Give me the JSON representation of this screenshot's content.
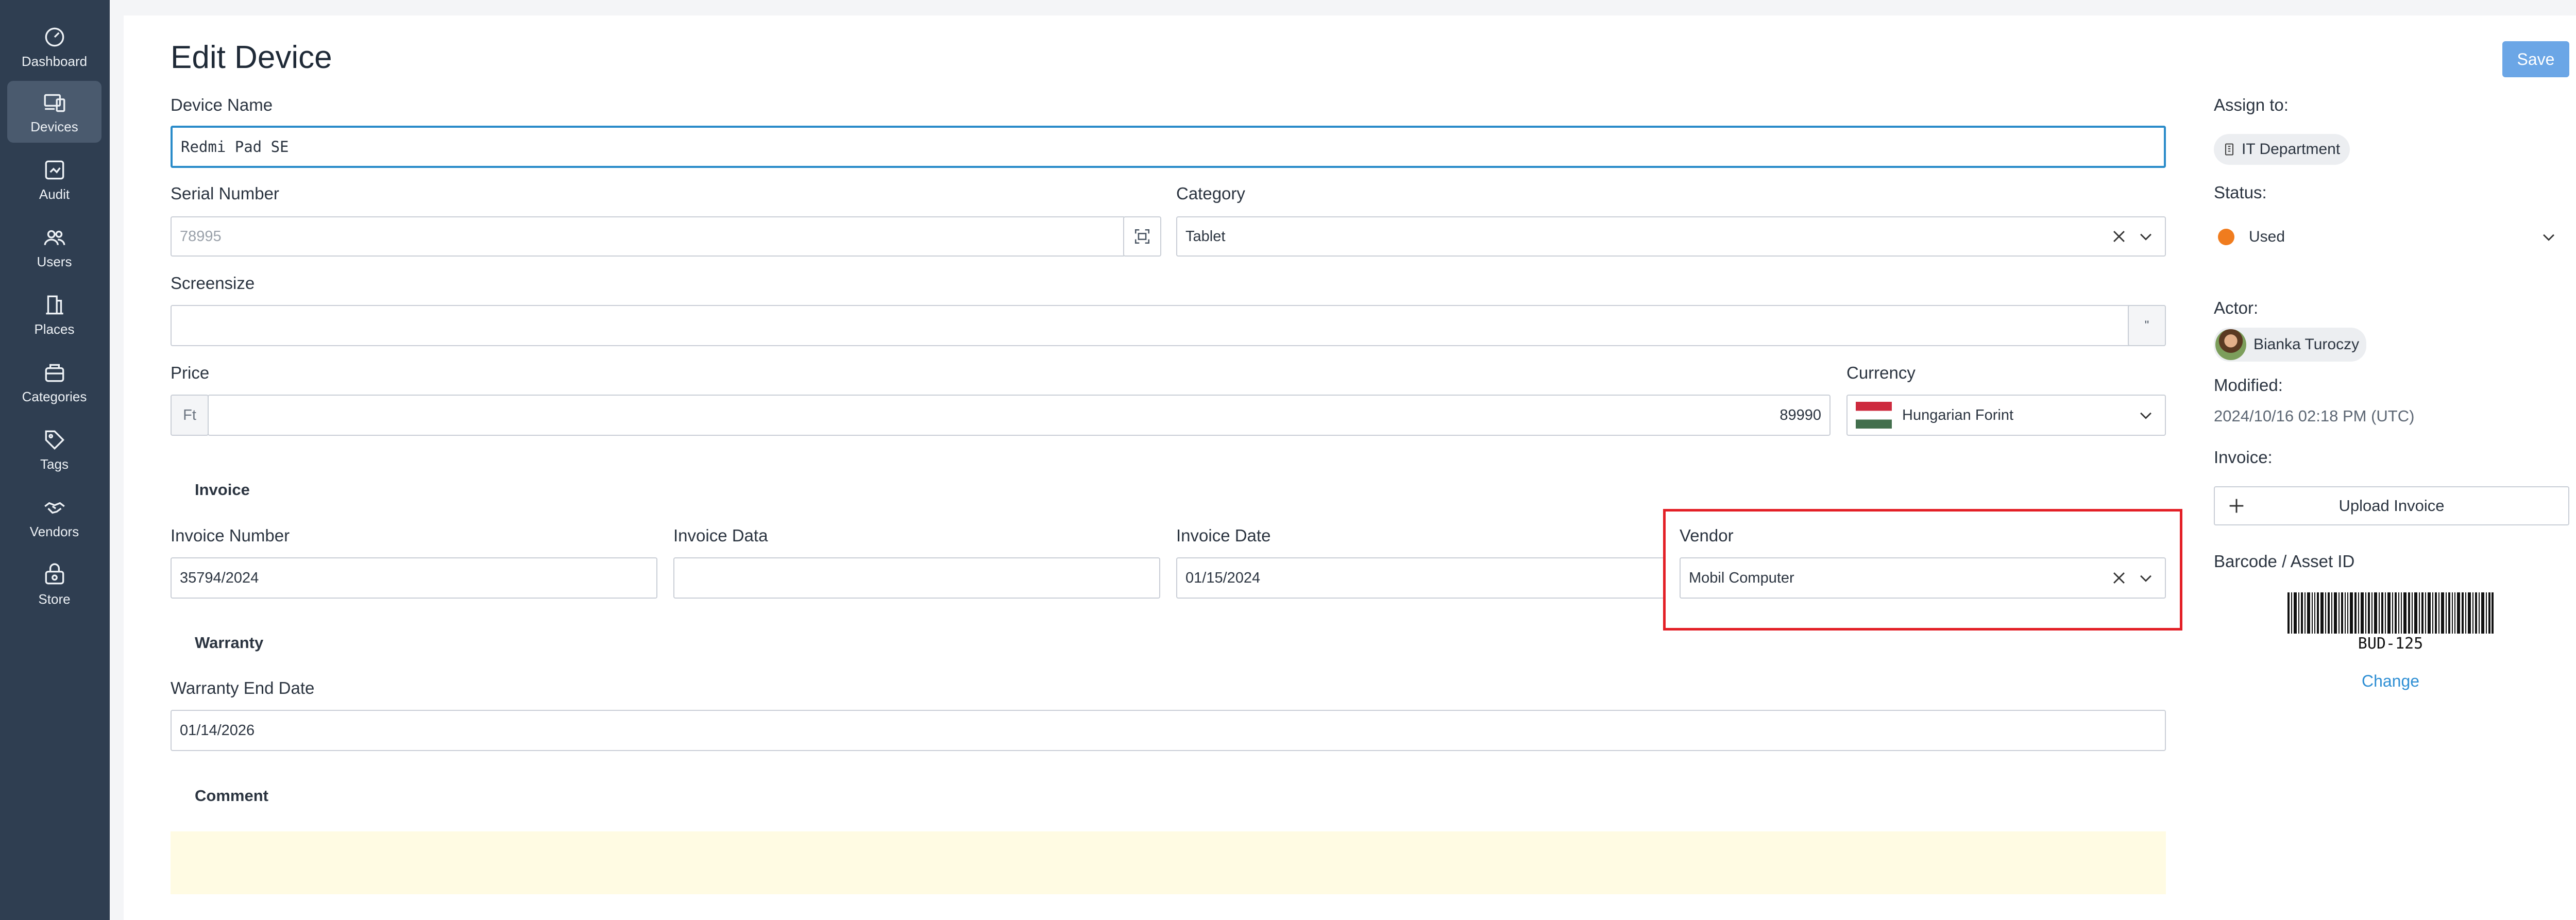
{
  "sidebar": {
    "items": [
      {
        "label": "Dashboard",
        "icon": "dashboard-icon"
      },
      {
        "label": "Devices",
        "icon": "devices-icon",
        "active": true
      },
      {
        "label": "Audit",
        "icon": "audit-icon"
      },
      {
        "label": "Users",
        "icon": "users-icon"
      },
      {
        "label": "Places",
        "icon": "places-icon"
      },
      {
        "label": "Categories",
        "icon": "categories-icon"
      },
      {
        "label": "Tags",
        "icon": "tags-icon"
      },
      {
        "label": "Vendors",
        "icon": "vendors-icon"
      },
      {
        "label": "Store",
        "icon": "store-icon"
      }
    ]
  },
  "page": {
    "title": "Edit Device",
    "save_label": "Save"
  },
  "form": {
    "device_name": {
      "label": "Device Name",
      "value": "Redmi Pad SE"
    },
    "serial_number": {
      "label": "Serial Number",
      "value": "78995"
    },
    "category": {
      "label": "Category",
      "value": "Tablet"
    },
    "screensize": {
      "label": "Screensize",
      "value": "",
      "unit": "\""
    },
    "price": {
      "label": "Price",
      "prefix": "Ft",
      "value": "89990"
    },
    "currency": {
      "label": "Currency",
      "value": "Hungarian Forint"
    },
    "invoice_section": "Invoice",
    "invoice_number": {
      "label": "Invoice Number",
      "value": "35794/2024"
    },
    "invoice_data": {
      "label": "Invoice Data",
      "value": ""
    },
    "invoice_date": {
      "label": "Invoice Date",
      "value": "01/15/2024"
    },
    "vendor": {
      "label": "Vendor",
      "value": "Mobil Computer"
    },
    "warranty_section": "Warranty",
    "warranty_end_date": {
      "label": "Warranty End Date",
      "value": "01/14/2026"
    },
    "comment_section": "Comment"
  },
  "side": {
    "assign_label": "Assign to:",
    "assign_value": "IT Department",
    "status_label": "Status:",
    "status_value": "Used",
    "status_color": "#f07c1e",
    "actor_label": "Actor:",
    "actor_value": "Bianka Turoczy",
    "modified_label": "Modified:",
    "modified_value": "2024/10/16 02:18 PM (UTC)",
    "invoice_label": "Invoice:",
    "upload_label": "Upload Invoice",
    "barcode_label": "Barcode / Asset ID",
    "barcode_value": "BUD-125",
    "change_label": "Change"
  },
  "colors": {
    "sidebar_bg": "#2f3e51",
    "accent": "#2a8bc9",
    "save_bg": "#6ba6e6",
    "highlight": "#e31f26"
  }
}
